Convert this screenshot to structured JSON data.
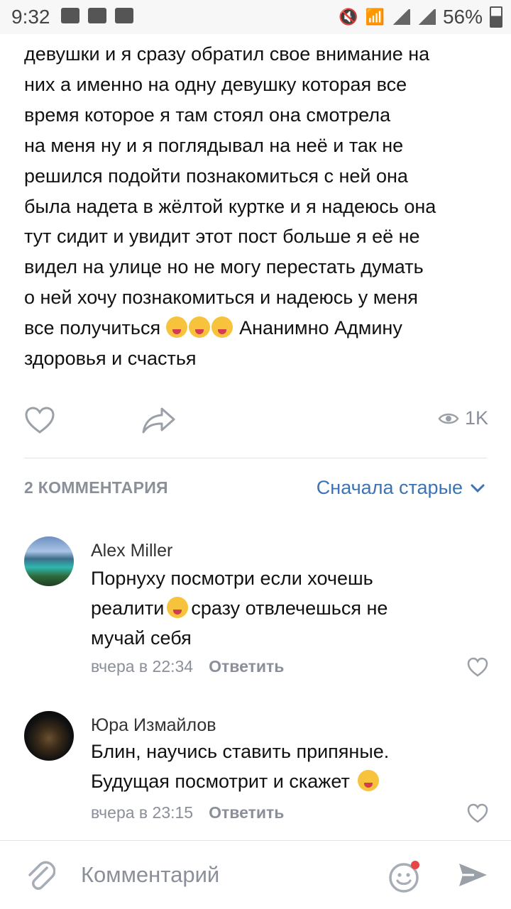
{
  "status_bar": {
    "time": "9:32",
    "battery": "56%"
  },
  "post": {
    "lines": [
      "девушки и я сразу обратил свое внимание на",
      "них а именно на одну девушку которая все",
      "время  которое я там стоял она смотрела",
      "на меня ну и я поглядывал на неё и так не",
      "решился подойти познакомиться с ней она",
      "была надета в жёлтой куртке и я надеюсь она",
      "тут сидит и увидит этот пост больше я её не",
      "видел на улице но не могу перестать думать",
      "о ней хочу познакомиться и надеюсь у меня"
    ],
    "line10_before": "все получиться ",
    "line10_after": " Ананимно  Админу",
    "line11": "здоровья и счастья",
    "views": "1K"
  },
  "comments_section": {
    "count_label": "2 КОММЕНТАРИЯ",
    "sort_label": "Сначала старые",
    "items": [
      {
        "author": "Alex Miller",
        "line1": "Порнуху посмотри если хочешь",
        "line2_before": "реалити",
        "line2_after": "сразу отвлечешься не",
        "line3": "мучай себя",
        "time": "вчера в 22:34",
        "reply": "Ответить"
      },
      {
        "author": "Юра Измайлов",
        "line1": "Блин, научись ставить припяные.",
        "line2": "Будущая посмотрит и скажет",
        "time": "вчера в 23:15",
        "reply": "Ответить"
      }
    ]
  },
  "composer": {
    "placeholder": "Комментарий"
  },
  "icons": {
    "like": "heart-icon",
    "share": "share-icon",
    "views": "eye-icon",
    "sort_chevron": "chevron-down-icon",
    "attach": "paperclip-icon",
    "emoji": "smile-icon",
    "send": "send-icon"
  },
  "colors": {
    "link": "#3c73b4",
    "muted": "#8a8f99",
    "notification_dot": "#e64646"
  }
}
